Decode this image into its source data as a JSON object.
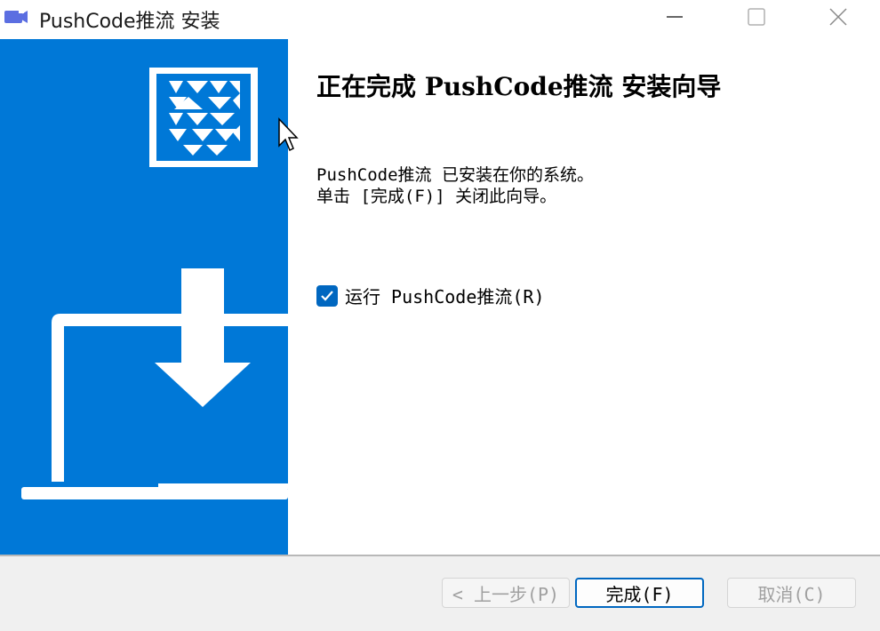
{
  "window": {
    "title": "PushCode推流 安装",
    "minimize_icon": "minimize-icon",
    "maximize_icon": "maximize-icon",
    "close_icon": "close-icon"
  },
  "sidebar": {
    "background_color": "#0078d7",
    "logo_icon": "pushcode-logo-icon",
    "illustration_icon": "download-to-laptop-icon"
  },
  "content": {
    "heading": "正在完成 PushCode推流 安装向导",
    "line1": "PushCode推流 已安装在你的系统。",
    "line2": "单击 [完成(F)] 关闭此向导。",
    "run_checkbox": {
      "label": "运行 PushCode推流(R)",
      "checked": true
    }
  },
  "footer": {
    "back_label": "< 上一步(P)",
    "finish_label": "完成(F)",
    "cancel_label": "取消(C)"
  },
  "colors": {
    "accent": "#0067c0",
    "sidebar": "#0078d7"
  }
}
